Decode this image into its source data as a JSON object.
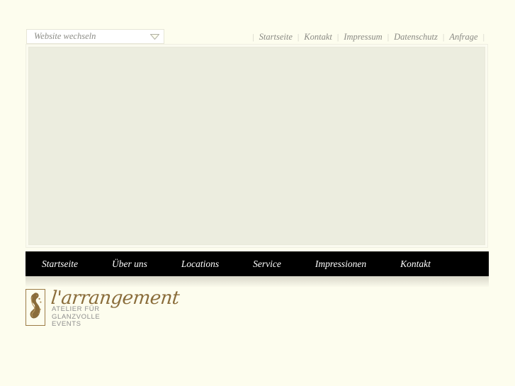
{
  "page": {
    "background_color": "#fdfdee",
    "panel_color": "#eceddf",
    "nav_bar_color": "#000000",
    "brand_color": "#8a6d3b"
  },
  "site_switcher": {
    "name": "site-switcher",
    "placeholder": "Website wechseln",
    "value": "Website wechseln",
    "icon": "chevron-down-icon"
  },
  "top_nav": {
    "separator": "|",
    "items": [
      {
        "label": "Startseite"
      },
      {
        "label": "Kontakt"
      },
      {
        "label": "Impressum"
      },
      {
        "label": "Datenschutz"
      },
      {
        "label": "Anfrage"
      }
    ]
  },
  "main_nav": {
    "items": [
      {
        "label": "Startseite"
      },
      {
        "label": "Über uns"
      },
      {
        "label": "Locations"
      },
      {
        "label": "Service"
      },
      {
        "label": "Impressionen"
      },
      {
        "label": "Kontakt"
      }
    ]
  },
  "content": {
    "body_text": ""
  },
  "logo": {
    "emblem_icon": "figure-emblem-icon",
    "script_text": "l'arrangement",
    "tagline_line1": "ATELIER FÜR",
    "tagline_line2": "GLANZVOLLE",
    "tagline_line3": "EVENTS"
  }
}
